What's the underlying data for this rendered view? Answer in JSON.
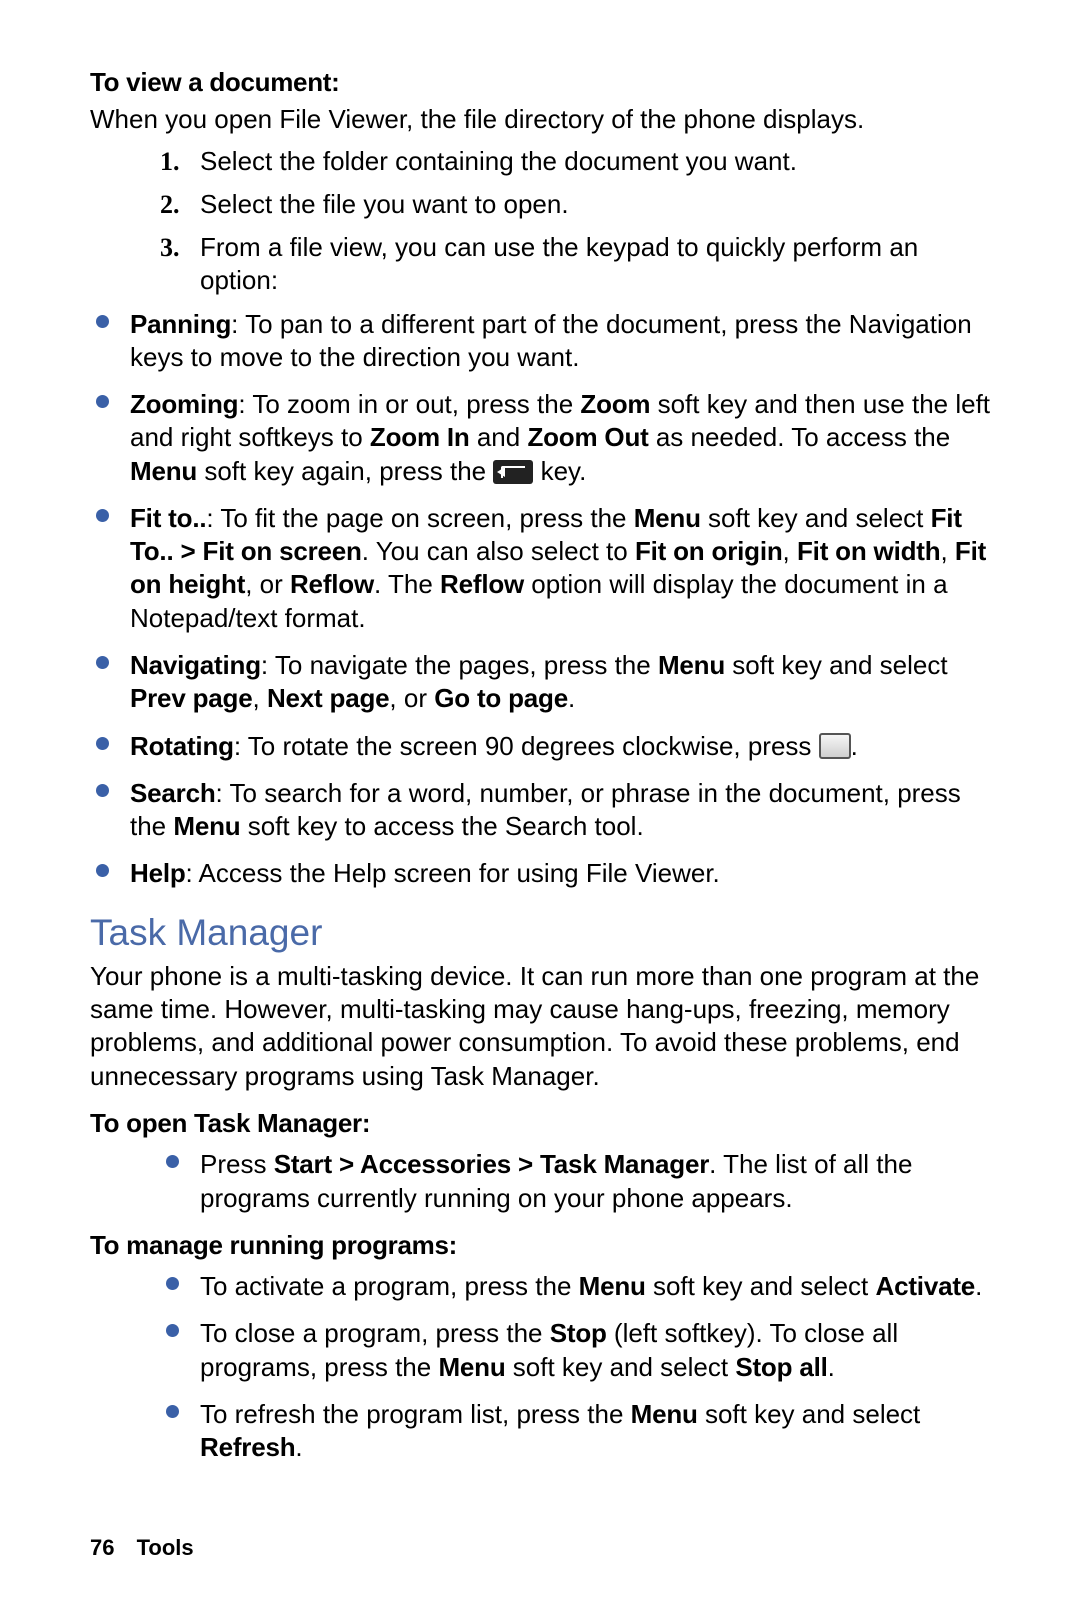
{
  "footer": {
    "page": "76",
    "chapter": "Tools"
  },
  "s1": {
    "head": "To view a document:",
    "intro": "When you open File Viewer, the file directory of the phone displays.",
    "step1": "Select the folder containing the document you want.",
    "step2": "Select the file you want to open.",
    "step3": "From a file view, you can use the keypad to quickly perform an option:",
    "num1": "1.",
    "num2": "2.",
    "num3": "3.",
    "panning_b": "Panning",
    "panning_t": ": To pan to a different part of the document, press the Navigation keys to move to the direction you want.",
    "zoom_b": "Zooming",
    "zoom_t1": ": To zoom in or out, press the ",
    "zoom_k1": "Zoom",
    "zoom_t2": " soft key and then use the left and right softkeys to ",
    "zoom_k2": "Zoom In",
    "zoom_t3": " and ",
    "zoom_k3": "Zoom Out",
    "zoom_t4": " as needed. To access the ",
    "zoom_k4": "Menu",
    "zoom_t5": " soft key again, press the ",
    "zoom_t6": " key.",
    "fit_b": "Fit to..",
    "fit_t1": ": To fit the page on screen, press the ",
    "fit_k1": "Menu",
    "fit_t2": " soft key and select ",
    "fit_k2": "Fit To.. > Fit on screen",
    "fit_t3": ". You can also select to ",
    "fit_k3": "Fit on origin",
    "fit_c1": ", ",
    "fit_k4": "Fit on width",
    "fit_c2": ", ",
    "fit_k5": "Fit on height",
    "fit_t4": ", or ",
    "fit_k6": "Reflow",
    "fit_t5": ". The ",
    "fit_k7": "Reflow",
    "fit_t6": " option will display the document in a Notepad/text format.",
    "nav_b": "Navigating",
    "nav_t1": ": To navigate the pages, press the ",
    "nav_k1": "Menu",
    "nav_t2": " soft key and select ",
    "nav_k2": "Prev page",
    "nav_c1": ", ",
    "nav_k3": "Next page",
    "nav_t3": ", or ",
    "nav_k4": "Go to page",
    "nav_t4": ".",
    "rot_b": "Rotating",
    "rot_t1": ": To rotate the screen 90 degrees clockwise, press ",
    "rot_t2": ".",
    "search_b": "Search",
    "search_t1": ": To search for a word, number, or phrase in the document, press the ",
    "search_k1": "Menu",
    "search_t2": " soft key to access the Search tool.",
    "help_b": "Help",
    "help_t": ": Access the Help screen for using File Viewer."
  },
  "s2": {
    "title": "Task Manager",
    "intro": "Your phone is a multi-tasking device. It can run more than one program at the same time. However, multi-tasking may cause hang-ups, freezing, memory problems, and additional power consumption. To avoid these problems, end unnecessary programs using Task Manager.",
    "head2": "To open Task Manager:",
    "open_t1": "Press ",
    "open_k1": "Start > Accessories > Task Manager",
    "open_t2": ". The list of all the programs currently running on your phone appears.",
    "head3": "To manage running programs:",
    "m1_t1": "To activate a program, press the ",
    "m1_k1": "Menu",
    "m1_t2": " soft key and select ",
    "m1_k2": "Activate",
    "m1_t3": ".",
    "m2_t1": "To close a program, press the ",
    "m2_k1": "Stop",
    "m2_t2": " (left softkey). To close all programs, press the ",
    "m2_k2": "Menu",
    "m2_t3": " soft key and select ",
    "m2_k3": "Stop all",
    "m2_t4": ".",
    "m3_t1": "To refresh the program list, press the ",
    "m3_k1": "Menu",
    "m3_t2": " soft key and select ",
    "m3_k2": "Refresh",
    "m3_t3": "."
  }
}
